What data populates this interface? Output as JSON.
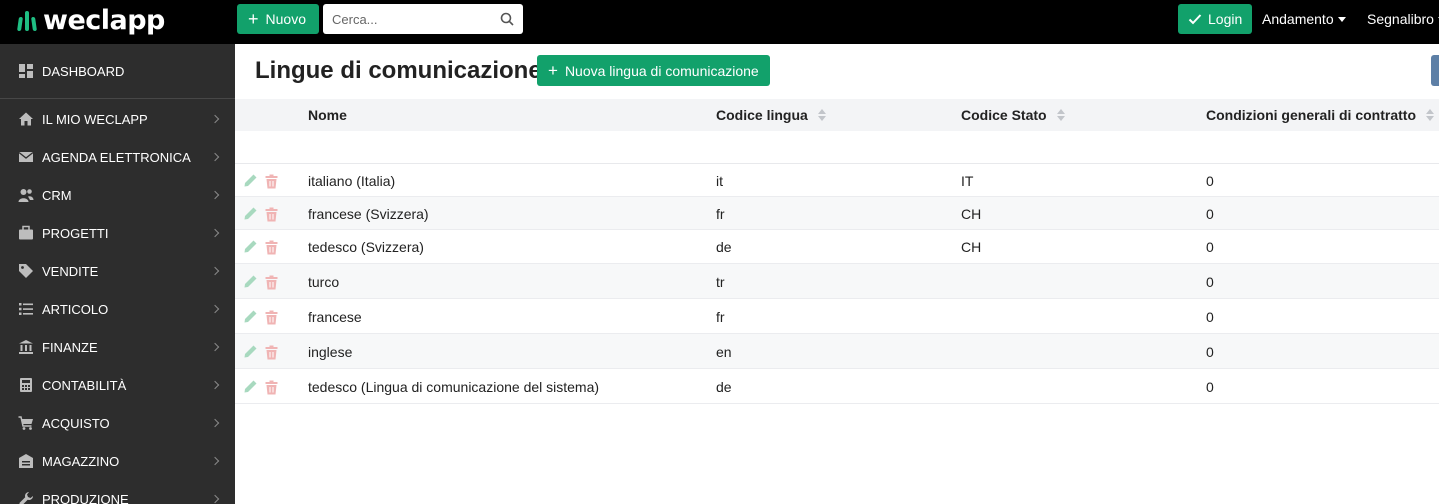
{
  "topbar": {
    "logo_text": "weclapp",
    "new_label": "Nuovo",
    "search_placeholder": "Cerca...",
    "login_label": "Login",
    "andamento_label": "Andamento",
    "segnalibro_label": "Segnalibro"
  },
  "sidebar": {
    "items": [
      {
        "label": "DASHBOARD",
        "icon": "dashboard-icon"
      },
      {
        "label": "IL MIO WECLAPP",
        "icon": "home-icon"
      },
      {
        "label": "AGENDA ELETTRONICA",
        "icon": "envelope-icon"
      },
      {
        "label": "CRM",
        "icon": "users-icon"
      },
      {
        "label": "PROGETTI",
        "icon": "briefcase-icon"
      },
      {
        "label": "VENDITE",
        "icon": "tag-icon"
      },
      {
        "label": "ARTICOLO",
        "icon": "list-icon"
      },
      {
        "label": "FINANZE",
        "icon": "bank-icon"
      },
      {
        "label": "CONTABILITÀ",
        "icon": "calculator-icon"
      },
      {
        "label": "ACQUISTO",
        "icon": "cart-icon"
      },
      {
        "label": "MAGAZZINO",
        "icon": "warehouse-icon"
      },
      {
        "label": "PRODUZIONE",
        "icon": "wrench-icon"
      }
    ]
  },
  "main": {
    "title": "Lingue di comunicazione",
    "new_language_label": "Nuova lingua di comunicazione"
  },
  "table": {
    "columns": [
      "Nome",
      "Codice lingua",
      "Codice Stato",
      "Condizioni generali di contratto"
    ],
    "rows": [
      [
        "italiano (Italia)",
        "it",
        "IT",
        "0"
      ],
      [
        "francese (Svizzera)",
        "fr",
        "CH",
        "0"
      ],
      [
        "tedesco (Svizzera)",
        "de",
        "CH",
        "0"
      ],
      [
        "turco",
        "tr",
        "",
        "0"
      ],
      [
        "francese",
        "fr",
        "",
        "0"
      ],
      [
        "inglese",
        "en",
        "",
        "0"
      ],
      [
        "tedesco (Lingua di comunicazione del sistema)",
        "de",
        "",
        "0"
      ]
    ]
  },
  "colors": {
    "topbar": "#000000",
    "sidebar": "#2d2d2d",
    "accent_green": "#12a16b",
    "edit_icon": "#a8d9bf",
    "delete_icon": "#f0b4b4"
  }
}
